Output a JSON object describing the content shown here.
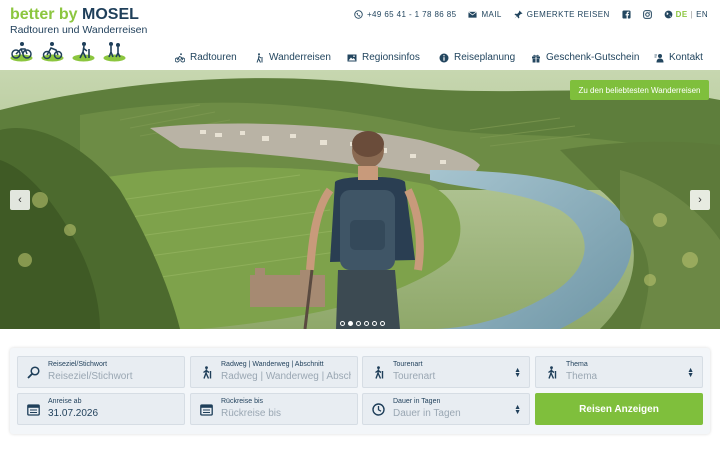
{
  "brand": {
    "word1": "better by",
    "word2": "MOSEL",
    "subtitle": "Radtouren und Wanderreisen",
    "green": "#8cc63f",
    "navy": "#1f3f5a"
  },
  "topbar": {
    "phone": "+49 65 41 - 1 78 86 85",
    "mail": "MAIL",
    "saved": "GEMERKTE REISEN",
    "lang_de": "DE",
    "lang_sep": "|",
    "lang_en": "EN"
  },
  "nav": {
    "items": [
      {
        "label": "Radtouren",
        "icon": "bike-icon"
      },
      {
        "label": "Wanderreisen",
        "icon": "hiker-icon"
      },
      {
        "label": "Regionsinfos",
        "icon": "image-icon"
      },
      {
        "label": "Reiseplanung",
        "icon": "info-icon"
      },
      {
        "label": "Geschenk-Gutschein",
        "icon": "gift-icon"
      },
      {
        "label": "Kontakt",
        "icon": "contact-icon"
      }
    ]
  },
  "hero": {
    "cta": "Zu den beliebtesten Wanderreisen",
    "prev": "‹",
    "next": "›",
    "slides_total": 6,
    "slide_active": 2
  },
  "search": {
    "fields": [
      {
        "label": "Reiseziel/Stichwort",
        "value": "Reiseziel/Stichwort",
        "icon": "search-icon"
      },
      {
        "label": "Radweg | Wanderweg | Abschnitt",
        "value": "Radweg | Wanderweg | Abschnitt",
        "icon": "hiker-icon"
      },
      {
        "label": "Tourenart",
        "value": "Tourenart",
        "icon": "hiker-icon"
      },
      {
        "label": "Thema",
        "value": "Thema",
        "icon": "hiker-icon"
      },
      {
        "label": "Anreise ab",
        "value": "31.07.2026",
        "icon": "calendar-icon"
      },
      {
        "label": "Rückreise bis",
        "value": "Rückreise bis",
        "icon": "calendar-icon"
      },
      {
        "label": "Dauer in Tagen",
        "value": "Dauer in Tagen",
        "icon": "clock-icon"
      }
    ],
    "submit": "Reisen Anzeigen"
  }
}
